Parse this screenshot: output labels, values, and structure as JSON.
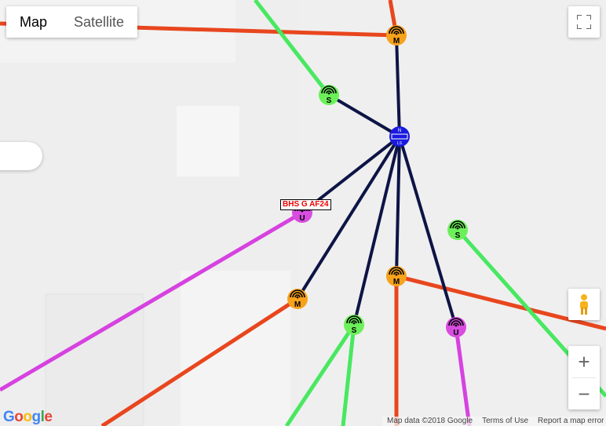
{
  "map_type": {
    "map_label": "Map",
    "satellite_label": "Satellite",
    "selected": "Map"
  },
  "controls": {
    "zoom_in": "+",
    "zoom_out": "−"
  },
  "attribution": {
    "logo": "Google",
    "map_data": "Map data ©2018 Google",
    "terms": "Terms of Use",
    "report": "Report a map error"
  },
  "marker_label": "BHS G AF24",
  "hub": {
    "top": "N",
    "bottom": "LS",
    "color": "#1a1adf"
  },
  "colors": {
    "orange_node": "#f7a21b",
    "green_node": "#6cf05a",
    "magenta_node": "#d84de0",
    "link_navy": "#0d1446",
    "line_red": "#e8461e",
    "line_green": "#48e860",
    "line_magenta": "#d642e0"
  },
  "nodes": [
    {
      "letter": "M",
      "color": "orange"
    },
    {
      "letter": "S",
      "color": "green"
    },
    {
      "letter": "U",
      "color": "magenta"
    },
    {
      "letter": "S",
      "color": "green"
    },
    {
      "letter": "M",
      "color": "orange"
    },
    {
      "letter": "M",
      "color": "orange"
    },
    {
      "letter": "S",
      "color": "green"
    },
    {
      "letter": "U",
      "color": "magenta"
    }
  ]
}
